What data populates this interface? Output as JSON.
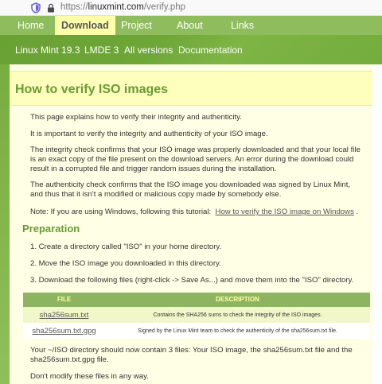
{
  "browser": {
    "url_scheme": "https://",
    "url_host": "linuxmint.com",
    "url_path": "/verify.php"
  },
  "topnav": {
    "items": [
      "Home",
      "Download",
      "Project",
      "About",
      "Links"
    ],
    "active": "Download"
  },
  "subnav": {
    "items": [
      "Linux Mint 19.3",
      "LMDE 3",
      "All versions",
      "Documentation"
    ]
  },
  "page": {
    "title": "How to verify ISO images",
    "intro": [
      "This page explains how to verify their integrity and authenticity.",
      "It is important to verify the integrity and authenticity of your ISO image.",
      "The integrity check confirms that your ISO image was properly downloaded and that your local file is an exact copy of the file present on the download servers. An error during the download could result in a corrupted file and trigger random issues during the installation.",
      "The authenticity check confirms that the ISO image you downloaded was signed by Linux Mint, and thus that it isn't a modified or malicious copy made by somebody else."
    ],
    "note_prefix": "Note: If you are using Windows, following this tutorial:",
    "note_link": "How to verify the ISO image on Windows",
    "note_suffix": ".",
    "preparation_heading": "Preparation",
    "steps": [
      "1. Create a directory called \"ISO\" in your home directory.",
      "2. Move the ISO image you downloaded in this directory.",
      "3. Download the following files (right-click -> Save As...) and move them into the \"ISO\" directory."
    ],
    "table": {
      "headers": [
        "FILE",
        "DESCRIPTION"
      ],
      "rows": [
        {
          "file": "sha256sum.txt",
          "description": "Contains the SHA256 sums to check the integrity of the ISO images."
        },
        {
          "file": "sha256sum.txt.gpg",
          "description": "Signed by the Linux Mint team to check the authenticity of the sha256sum.txt file."
        }
      ]
    },
    "after_table": [
      "Your ~/ISO directory should now contain 3 files: Your ISO image, the sha256sum.txt file and the sha256sum.txt.gpg file.",
      "Don't modify these files in any way."
    ]
  },
  "colors": {
    "brand_green": "#8fbd5d",
    "title_green": "#6a9a35",
    "active_tab": "#ffffaa",
    "content_bg": "#ffffe5"
  }
}
